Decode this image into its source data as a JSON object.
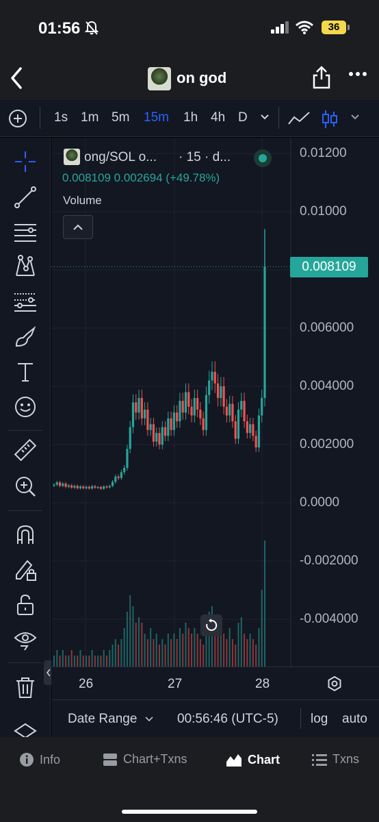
{
  "status_bar": {
    "time": "01:56",
    "battery": "36",
    "icons": [
      "bell-slash-icon",
      "signal-icon",
      "wifi-icon",
      "battery-icon"
    ]
  },
  "nav": {
    "title": "on god",
    "icons": [
      "back-icon",
      "share-icon",
      "more-icon"
    ]
  },
  "toolbar": {
    "timeframes": [
      "1s",
      "1m",
      "5m",
      "15m",
      "1h",
      "4h",
      "D"
    ],
    "active_timeframe": "15m",
    "icons": [
      "plus-icon",
      "chevron-down-icon",
      "line-chart-icon",
      "candlestick-icon"
    ]
  },
  "tools": [
    "crosshair-icon",
    "trend-line-icon",
    "horizontal-lines-icon",
    "pattern-icon",
    "fib-icon",
    "brush-icon",
    "text-icon",
    "emoji-icon",
    "ruler-icon",
    "zoom-in-icon",
    "magnet-icon",
    "lock-pencil-icon",
    "unlock-icon",
    "eye-icon",
    "trash-icon",
    "layers-icon"
  ],
  "legend": {
    "title": "ong/SOL o...",
    "interval": "· 15 · d...",
    "last": "0.008109",
    "change": "0.002694",
    "change_pct": "(+49.78%)",
    "volume_label": "Volume"
  },
  "price_axis": {
    "labels": [
      "0.01200",
      "0.01000",
      "0.006000",
      "0.004000",
      "0.002000",
      "0.0000",
      "-0.002000",
      "-0.004000"
    ],
    "last_price": "0.008109"
  },
  "time_axis": {
    "labels": [
      "26",
      "27",
      "28"
    ]
  },
  "range_bar": {
    "date_range": "Date Range",
    "clock": "00:56:46 (UTC-5)",
    "log": "log",
    "auto": "auto"
  },
  "tabs": [
    {
      "label": "Info",
      "icon": "info-icon"
    },
    {
      "label": "Chart+Txns",
      "icon": "split-view-icon"
    },
    {
      "label": "Chart",
      "icon": "chart-icon"
    },
    {
      "label": "Txns",
      "icon": "list-icon"
    }
  ],
  "active_tab": "Chart",
  "colors": {
    "up": "#26a69a",
    "down": "#ef5350",
    "accent": "#2962ff",
    "background": "#131722"
  },
  "chart_data": {
    "type": "candlestick",
    "symbol": "ong/SOL",
    "interval": "15",
    "x_ticks": [
      "26",
      "27",
      "28"
    ],
    "y_ticks": [
      "0.01200",
      "0.01000",
      "0.006000",
      "0.004000",
      "0.002000",
      "0.0000",
      "-0.002000",
      "-0.004000"
    ],
    "series": [
      {
        "name": "Price",
        "points": [
          {
            "x": 0,
            "close": 0.00062
          },
          {
            "x": 1,
            "close": 0.0007
          },
          {
            "x": 2,
            "close": 0.00058
          },
          {
            "x": 3,
            "close": 0.00066
          },
          {
            "x": 4,
            "close": 0.00055
          },
          {
            "x": 5,
            "close": 0.0006
          },
          {
            "x": 6,
            "close": 0.00052
          },
          {
            "x": 7,
            "close": 0.00058
          },
          {
            "x": 8,
            "close": 0.0005
          },
          {
            "x": 9,
            "close": 0.00056
          },
          {
            "x": 10,
            "close": 0.0005
          },
          {
            "x": 11,
            "close": 0.00055
          },
          {
            "x": 12,
            "close": 0.00049
          },
          {
            "x": 13,
            "close": 0.00057
          },
          {
            "x": 14,
            "close": 0.00052
          },
          {
            "x": 15,
            "close": 0.00054
          },
          {
            "x": 16,
            "close": 0.00048
          },
          {
            "x": 17,
            "close": 0.00056
          },
          {
            "x": 18,
            "close": 0.00053
          },
          {
            "x": 19,
            "close": 0.00058
          },
          {
            "x": 20,
            "close": 0.00072
          },
          {
            "x": 21,
            "close": 0.0009
          },
          {
            "x": 22,
            "close": 0.00085
          },
          {
            "x": 23,
            "close": 0.00105
          },
          {
            "x": 24,
            "close": 0.0012
          },
          {
            "x": 25,
            "close": 0.00185
          },
          {
            "x": 26,
            "close": 0.0026
          },
          {
            "x": 27,
            "close": 0.00345
          },
          {
            "x": 28,
            "close": 0.0031
          },
          {
            "x": 29,
            "close": 0.0036
          },
          {
            "x": 30,
            "close": 0.0029
          },
          {
            "x": 31,
            "close": 0.0032
          },
          {
            "x": 32,
            "close": 0.0025
          },
          {
            "x": 33,
            "close": 0.0027
          },
          {
            "x": 34,
            "close": 0.0021
          },
          {
            "x": 35,
            "close": 0.0024
          },
          {
            "x": 36,
            "close": 0.002
          },
          {
            "x": 37,
            "close": 0.0026
          },
          {
            "x": 38,
            "close": 0.0023
          },
          {
            "x": 39,
            "close": 0.0029
          },
          {
            "x": 40,
            "close": 0.0025
          },
          {
            "x": 41,
            "close": 0.0031
          },
          {
            "x": 42,
            "close": 0.0028
          },
          {
            "x": 43,
            "close": 0.0035
          },
          {
            "x": 44,
            "close": 0.0031
          },
          {
            "x": 45,
            "close": 0.0038
          },
          {
            "x": 46,
            "close": 0.0033
          },
          {
            "x": 47,
            "close": 0.003
          },
          {
            "x": 48,
            "close": 0.0036
          },
          {
            "x": 49,
            "close": 0.0032
          },
          {
            "x": 50,
            "close": 0.0029
          },
          {
            "x": 51,
            "close": 0.0025
          },
          {
            "x": 52,
            "close": 0.0037
          },
          {
            "x": 53,
            "close": 0.0042
          },
          {
            "x": 54,
            "close": 0.0045
          },
          {
            "x": 55,
            "close": 0.0041
          },
          {
            "x": 56,
            "close": 0.0036
          },
          {
            "x": 57,
            "close": 0.004
          },
          {
            "x": 58,
            "close": 0.0033
          },
          {
            "x": 59,
            "close": 0.003
          },
          {
            "x": 60,
            "close": 0.0034
          },
          {
            "x": 61,
            "close": 0.0028
          },
          {
            "x": 62,
            "close": 0.0022
          },
          {
            "x": 63,
            "close": 0.0032
          },
          {
            "x": 64,
            "close": 0.0035
          },
          {
            "x": 65,
            "close": 0.0028
          },
          {
            "x": 66,
            "close": 0.0024
          },
          {
            "x": 67,
            "close": 0.0027
          },
          {
            "x": 68,
            "close": 0.0023
          },
          {
            "x": 69,
            "close": 0.0019
          },
          {
            "x": 70,
            "close": 0.003
          },
          {
            "x": 71,
            "close": 0.0036
          },
          {
            "x": 72,
            "close": 0.00811
          }
        ]
      },
      {
        "name": "Volume",
        "values": [
          0.2,
          0.3,
          0.2,
          0.3,
          0.2,
          0.2,
          0.3,
          0.2,
          0.2,
          0.3,
          0.2,
          0.2,
          0.2,
          0.3,
          0.2,
          0.2,
          0.2,
          0.3,
          0.2,
          0.3,
          0.4,
          0.5,
          0.4,
          0.5,
          0.7,
          1.0,
          1.3,
          1.1,
          0.8,
          0.9,
          0.8,
          0.6,
          0.5,
          0.7,
          0.5,
          0.6,
          0.4,
          0.5,
          0.4,
          0.6,
          0.5,
          0.6,
          0.5,
          0.7,
          0.6,
          0.8,
          0.7,
          0.6,
          0.7,
          0.6,
          0.5,
          0.4,
          0.8,
          1.0,
          1.1,
          0.9,
          0.7,
          0.8,
          0.6,
          0.5,
          0.7,
          0.5,
          0.4,
          0.8,
          0.9,
          0.6,
          0.5,
          0.6,
          0.5,
          0.4,
          0.7,
          1.4,
          2.3
        ]
      }
    ],
    "last_value": 0.008109,
    "ylim": [
      -0.0045,
      0.0125
    ]
  }
}
